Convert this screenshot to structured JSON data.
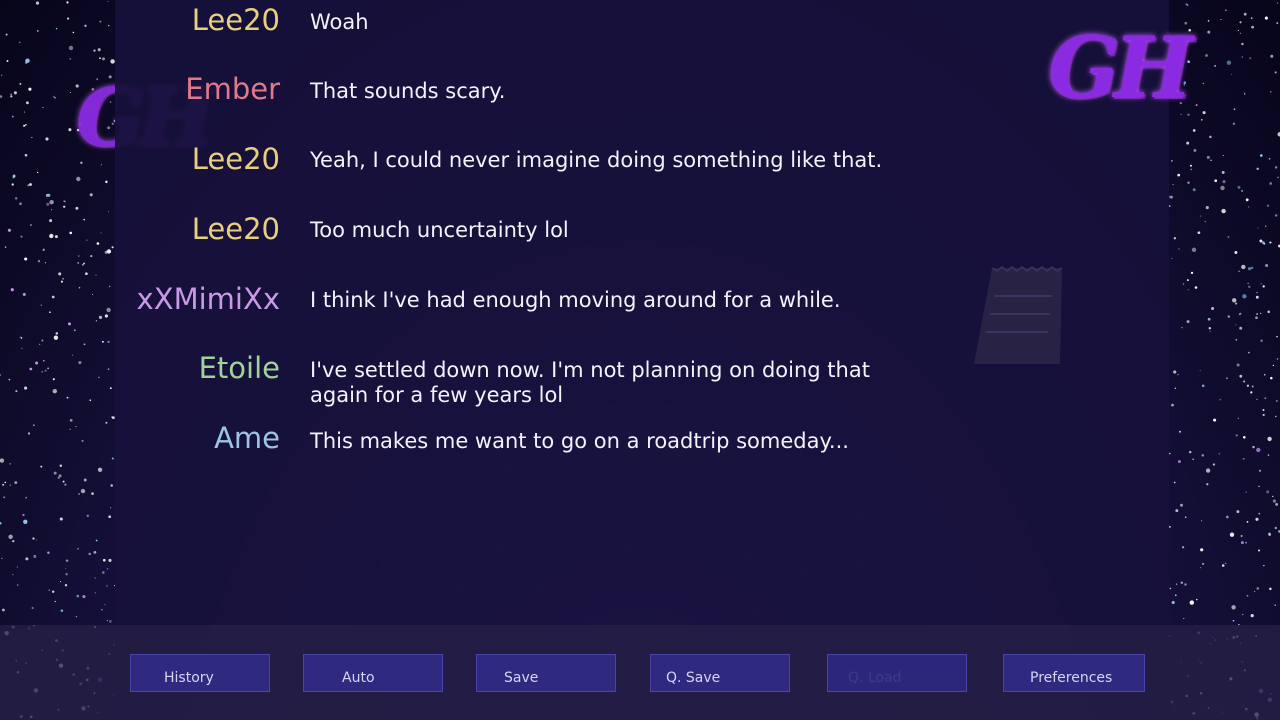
{
  "messages": [
    {
      "name": "Lee20",
      "text": "Woah",
      "color": "#e8d07a"
    },
    {
      "name": "Ember",
      "text": "That sounds scary.",
      "color": "#e07a8a"
    },
    {
      "name": "Lee20",
      "text": "Yeah, I could never imagine doing something like that.",
      "color": "#e8d07a"
    },
    {
      "name": "Lee20",
      "text": "Too much uncertainty lol",
      "color": "#e8d07a"
    },
    {
      "name": "xXMimiXx",
      "text": "I think I've had enough moving around for a while.",
      "color": "#c89ae6"
    },
    {
      "name": "Etoile",
      "text": "I've settled down now. I'm not planning on doing that again for a few years lol",
      "color": "#9fd39a"
    },
    {
      "name": "Ame",
      "text": "This makes me want to go on a roadtrip someday...",
      "color": "#9cc4e4"
    }
  ],
  "logo": {
    "text": "GH",
    "color": "#8a2be2"
  },
  "quick_menu": {
    "history": "History",
    "auto": "Auto",
    "save": "Save",
    "qsave": "Q. Save",
    "qload": "Q. Load",
    "preferences": "Preferences"
  },
  "icons": {
    "note": "note-icon"
  }
}
